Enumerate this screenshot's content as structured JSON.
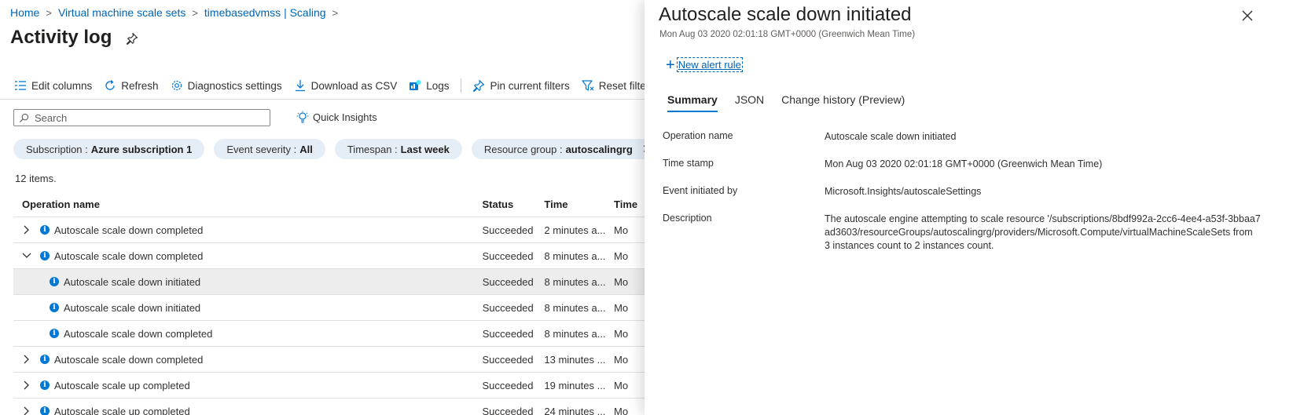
{
  "breadcrumb": [
    "Home",
    "Virtual machine scale sets",
    "timebasedvmss | Scaling"
  ],
  "page_title": "Activity log",
  "toolbar": {
    "edit_columns": "Edit columns",
    "refresh": "Refresh",
    "diagnostics": "Diagnostics settings",
    "download_csv": "Download as CSV",
    "logs": "Logs",
    "pin_filters": "Pin current filters",
    "reset_filters": "Reset filters"
  },
  "search": {
    "placeholder": "Search"
  },
  "quick_insights": "Quick Insights",
  "filters": [
    {
      "label": "Subscription :",
      "value": "Azure subscription 1"
    },
    {
      "label": "Event severity :",
      "value": "All"
    },
    {
      "label": "Timespan :",
      "value": "Last week"
    },
    {
      "label": "Resource group :",
      "value": "autoscalingrg"
    }
  ],
  "item_count": "12 items.",
  "table": {
    "headers": [
      "Operation name",
      "Status",
      "Time",
      "Time"
    ],
    "rows": [
      {
        "name": "Autoscale scale down completed",
        "status": "Succeeded",
        "time": "2 minutes a...",
        "time2": "Mo"
      },
      {
        "name": "Autoscale scale down completed",
        "status": "Succeeded",
        "time": "8 minutes a...",
        "time2": "Mo"
      },
      {
        "name": "Autoscale scale down initiated",
        "status": "Succeeded",
        "time": "8 minutes a...",
        "time2": "Mo"
      },
      {
        "name": "Autoscale scale down initiated",
        "status": "Succeeded",
        "time": "8 minutes a...",
        "time2": "Mo"
      },
      {
        "name": "Autoscale scale down completed",
        "status": "Succeeded",
        "time": "8 minutes a...",
        "time2": "Mo"
      },
      {
        "name": "Autoscale scale down completed",
        "status": "Succeeded",
        "time": "13 minutes ...",
        "time2": "Mo"
      },
      {
        "name": "Autoscale scale up completed",
        "status": "Succeeded",
        "time": "19 minutes ...",
        "time2": "Mo"
      },
      {
        "name": "Autoscale scale up completed",
        "status": "Succeeded",
        "time": "24 minutes ...",
        "time2": "Mo"
      }
    ]
  },
  "panel": {
    "title": "Autoscale scale down initiated",
    "subtitle": "Mon Aug 03 2020 02:01:18 GMT+0000 (Greenwich Mean Time)",
    "new_alert_rule": "New alert rule",
    "tabs": [
      "Summary",
      "JSON",
      "Change history (Preview)"
    ],
    "details": [
      {
        "label": "Operation name",
        "value": "Autoscale scale down initiated"
      },
      {
        "label": "Time stamp",
        "value": "Mon Aug 03 2020 02:01:18 GMT+0000 (Greenwich Mean Time)"
      },
      {
        "label": "Event initiated by",
        "value": "Microsoft.Insights/autoscaleSettings"
      },
      {
        "label": "Description",
        "value": "The autoscale engine attempting to scale resource '/subscriptions/8bdf992a-2cc6-4ee4-a53f-3bbaa7ad3603/resourceGroups/autoscalingrg/providers/Microsoft.Compute/virtualMachineScaleSets from 3 instances count to 2 instances count."
      }
    ]
  },
  "colors": {
    "link": "#0064b4",
    "accent": "#0078d4",
    "pill_bg": "#e5eef7",
    "selected_row": "#ededed"
  }
}
